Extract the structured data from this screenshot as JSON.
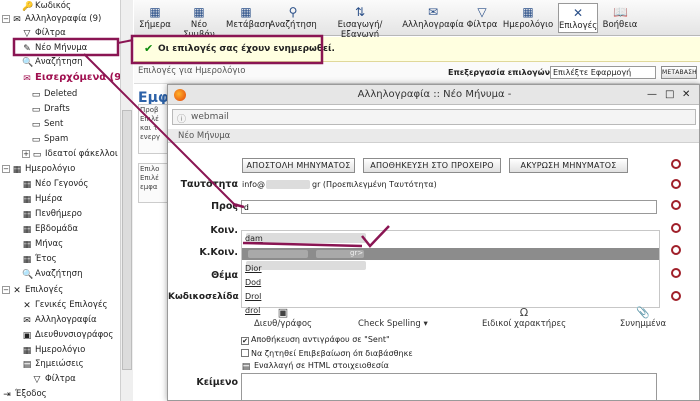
{
  "sidebar": {
    "items": [
      {
        "label": "Κωδικός",
        "icon": "key-icon"
      },
      {
        "label": "Αλληλογραφία (9)",
        "icon": "mail-folder-icon"
      },
      {
        "label": "Φίλτρα",
        "icon": "filter-icon"
      },
      {
        "label": "Νέο Μήνυμα",
        "icon": "compose-icon"
      },
      {
        "label": "Αναζήτηση",
        "icon": "search-icon"
      },
      {
        "label": "Εισερχόμενα (9",
        "icon": "inbox-icon"
      },
      {
        "label": "Deleted",
        "icon": "folder-icon"
      },
      {
        "label": "Drafts",
        "icon": "folder-icon"
      },
      {
        "label": "Sent",
        "icon": "folder-icon"
      },
      {
        "label": "Spam",
        "icon": "folder-icon"
      },
      {
        "label": "Ιδεατοί φάκελλοι",
        "icon": "virtual-folder-icon"
      },
      {
        "label": "Ημερολόγιο",
        "icon": "calendar-icon"
      },
      {
        "label": "Νέο Γεγονός",
        "icon": "new-event-icon"
      },
      {
        "label": "Ημέρα",
        "icon": "day-icon"
      },
      {
        "label": "Πενθήμερο",
        "icon": "workweek-icon"
      },
      {
        "label": "Εβδομάδα",
        "icon": "week-icon"
      },
      {
        "label": "Μήνας",
        "icon": "month-icon"
      },
      {
        "label": "Έτος",
        "icon": "year-icon"
      },
      {
        "label": "Αναζήτηση",
        "icon": "search-icon"
      },
      {
        "label": "Επιλογές",
        "icon": "options-icon"
      },
      {
        "label": "Γενικές Επιλογές",
        "icon": "general-options-icon"
      },
      {
        "label": "Αλληλογραφία",
        "icon": "mail-options-icon"
      },
      {
        "label": "Διευθυνσιογράφος",
        "icon": "addressbook-icon"
      },
      {
        "label": "Ημερολόγιο",
        "icon": "calendar-icon"
      },
      {
        "label": "Σημειώσεις",
        "icon": "notes-icon"
      },
      {
        "label": "Φίλτρα",
        "icon": "filter-icon"
      },
      {
        "label": "Έξοδος",
        "icon": "exit-icon"
      }
    ]
  },
  "toolbar": {
    "items": [
      {
        "label": "Σήμερα",
        "icon": "today-icon"
      },
      {
        "label": "Νέο Συμβάν",
        "icon": "new-event-icon"
      },
      {
        "label": "Μετάβαση",
        "icon": "goto-icon"
      },
      {
        "label": "Αναζήτηση",
        "icon": "search-icon"
      },
      {
        "label": "Εισαγωγή/Εξαγωγή",
        "icon": "import-export-icon"
      },
      {
        "label": "Αλληλογραφία",
        "icon": "mail-icon"
      },
      {
        "label": "Φίλτρα",
        "icon": "filter-icon"
      },
      {
        "label": "Ημερολόγιο",
        "icon": "calendar-icon"
      },
      {
        "label": "Επιλογές",
        "icon": "options-icon"
      },
      {
        "label": "Βοήθεια",
        "icon": "help-icon"
      }
    ]
  },
  "notice": "Οι επιλογές σας έχουν ενημερωθεί.",
  "options_page": {
    "subtitle": "Επιλογές για Ημερολόγιο",
    "edit_label": "Επεξεργασία επιλογών για:",
    "select_placeholder": "Επιλέξτε Εφαρμογή",
    "go_button": "ΜΕΤΑΒΑΣΗ",
    "heading_fragment": "Εμφ",
    "box1_lines": [
      "Προβ",
      "Επιλέ",
      "και τ",
      "ενεργ"
    ],
    "box2_lines": [
      "Επιλο",
      "Επιλέ",
      "εμφα"
    ]
  },
  "popup": {
    "title": "Αλληλογραφία :: Νέο Μήνυμα -",
    "url": "webmail",
    "header": "Νέο Μήνυμα",
    "buttons": {
      "send": "ΑΠΟΣΤΟΛΗ ΜΗΝΥΜΑΤΟΣ",
      "save_draft": "ΑΠΟΘΗΚΕΥΣΗ ΣΤΟ ΠΡΟΧΕΙΡΟ",
      "cancel": "ΑΚΥΡΩΣΗ ΜΗΝΥΜΑΤΟΣ"
    },
    "labels": {
      "identity": "Ταυτότητα",
      "to": "Προς",
      "cc": "Κοιν.",
      "bcc": "Κ.Κοιν.",
      "subject": "Θέμα",
      "charset": "Κωδικοσελίδα",
      "body": "Κείμενο"
    },
    "identity_prefix": "info@",
    "identity_suffix": "gr (Προεπιλεγμένη Ταυτότητα)",
    "to_value": "d",
    "autocomplete": [
      "dam",
      "",
      "Dior",
      "Dod",
      "Drol",
      "drol"
    ],
    "selected_suffix": "gr>",
    "tools": {
      "addressbook": "Διευθ/γράφος",
      "spell": "Check Spelling",
      "special_chars": "Ειδικοί χαρακτήρες",
      "attachments": "Συνημμένα"
    },
    "checks": [
      {
        "label": "Αποθήκευση αντιγράφου σε \"Sent\"",
        "checked": true
      },
      {
        "label": "Να ζητηθεί Επιβεβαίωση όπ διαβάσθηκε",
        "checked": false
      }
    ],
    "html_toggle": "Εναλλαγή σε HTML στοιχειοθεσία"
  },
  "colors": {
    "annotation": "#8a1553",
    "notice_bg": "#ffffe0",
    "selection": "#8c8c8c",
    "heading_blue": "#2d62a8"
  }
}
